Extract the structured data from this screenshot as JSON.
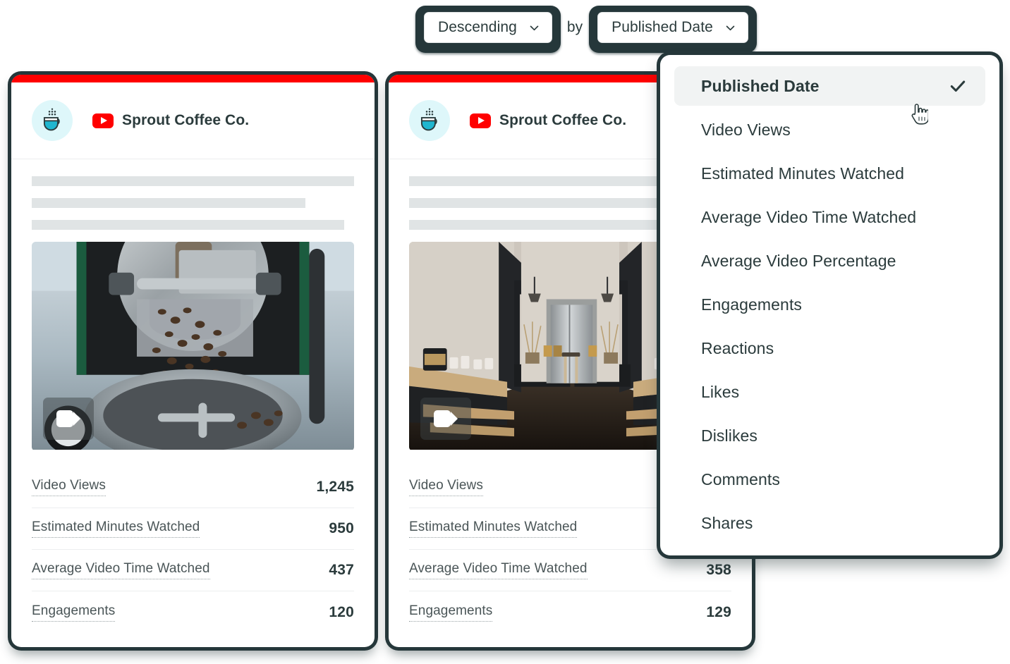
{
  "sort_bar": {
    "direction_label": "Descending",
    "conjunction": "by",
    "field_label": "Published Date",
    "direction_icon": "chevron-down-icon",
    "field_icon": "chevron-down-icon"
  },
  "dropdown": {
    "selected": "Published Date",
    "check_icon": "check-icon",
    "items": [
      {
        "label": "Published Date",
        "selected": true
      },
      {
        "label": "Video Views",
        "selected": false
      },
      {
        "label": "Estimated Minutes Watched",
        "selected": false
      },
      {
        "label": "Average Video Time Watched",
        "selected": false
      },
      {
        "label": "Average Video Percentage",
        "selected": false
      },
      {
        "label": "Engagements",
        "selected": false
      },
      {
        "label": "Reactions",
        "selected": false
      },
      {
        "label": "Likes",
        "selected": false
      },
      {
        "label": "Dislikes",
        "selected": false
      },
      {
        "label": "Comments",
        "selected": false
      },
      {
        "label": "Shares",
        "selected": false
      }
    ]
  },
  "cursor": {
    "icon": "pointing-hand-cursor"
  },
  "colors": {
    "network_accent": "#FF0000",
    "frame_dark": "#25373A",
    "avatar_bg": "#DEF7FA",
    "avatar_accent": "#1FA9C4",
    "skeleton": "#E0E4E5",
    "selected_row_bg": "#F1F3F3"
  },
  "cards": [
    {
      "accent": "#FF0000",
      "avatar_icon": "coffee-cup-icon",
      "network_icon": "youtube-icon",
      "profile_name": "Sprout Coffee Co.",
      "skeleton_widths": [
        "100%",
        "85%",
        "97%"
      ],
      "media_badge_icon": "video-camera-icon",
      "media_alt": "coffee-roaster-photo",
      "metrics": [
        {
          "label": "Video Views",
          "value": "1,245"
        },
        {
          "label": "Estimated Minutes Watched",
          "value": "950"
        },
        {
          "label": "Average Video Time Watched",
          "value": "437"
        },
        {
          "label": "Engagements",
          "value": "120"
        }
      ]
    },
    {
      "accent": "#FF0000",
      "avatar_icon": "coffee-cup-icon",
      "network_icon": "youtube-icon",
      "profile_name": "Sprout Coffee Co.",
      "skeleton_widths": [
        "100%",
        "81%",
        "100%"
      ],
      "media_badge_icon": "video-camera-icon",
      "media_alt": "coffee-shop-interior-photo",
      "metrics": [
        {
          "label": "Video Views",
          "value": ""
        },
        {
          "label": "Estimated Minutes Watched",
          "value": ""
        },
        {
          "label": "Average Video Time Watched",
          "value": "358"
        },
        {
          "label": "Engagements",
          "value": "129"
        }
      ]
    }
  ]
}
